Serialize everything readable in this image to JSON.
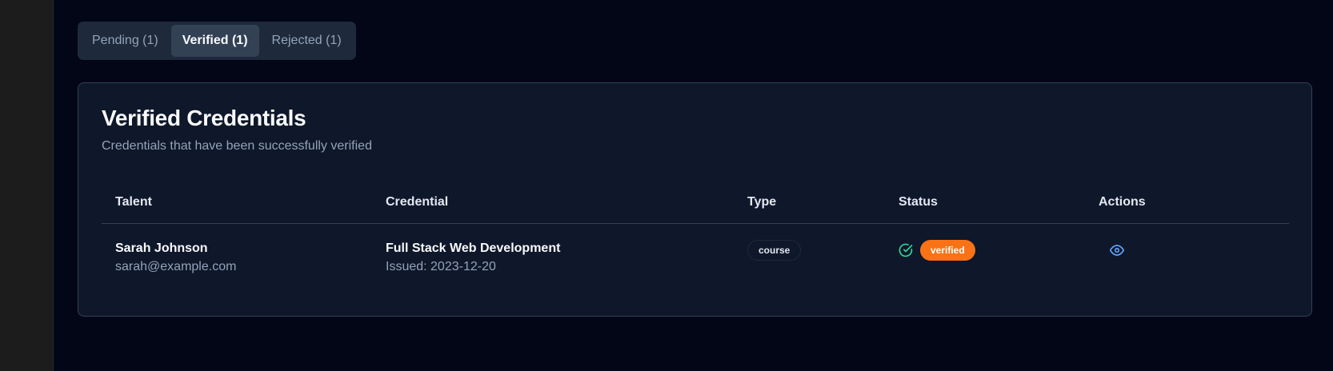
{
  "tabs": [
    {
      "label": "Pending (1)"
    },
    {
      "label": "Verified (1)",
      "active": true
    },
    {
      "label": "Rejected (1)"
    }
  ],
  "card": {
    "title": "Verified Credentials",
    "description": "Credentials that have been successfully verified"
  },
  "table": {
    "headers": [
      "Talent",
      "Credential",
      "Type",
      "Status",
      "Actions"
    ],
    "rows": [
      {
        "talent_name": "Sarah Johnson",
        "talent_email": "sarah@example.com",
        "credential_name": "Full Stack Web Development",
        "credential_issued": "Issued: 2023-12-20",
        "type": "course",
        "status": "verified",
        "status_icon": "check-circle-icon",
        "action_icon": "eye-icon"
      }
    ]
  },
  "colors": {
    "background": "#020617",
    "card": "#0f172a",
    "status_verified": "#f97316",
    "check_icon": "#34d399",
    "action_icon": "#60a5fa"
  }
}
